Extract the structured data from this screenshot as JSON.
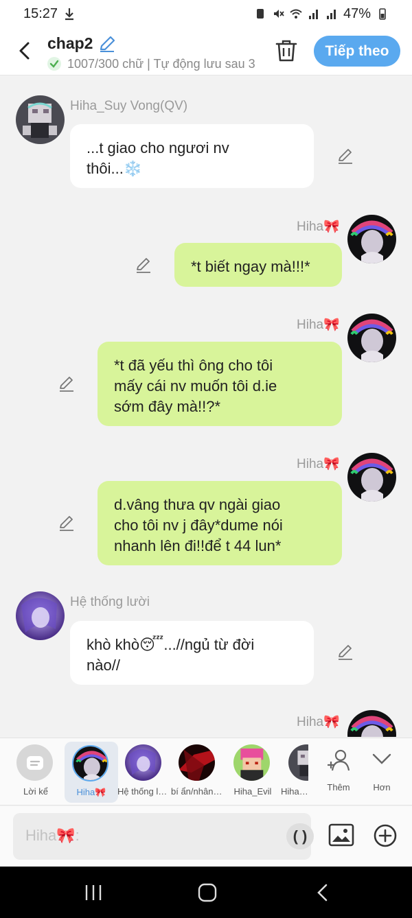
{
  "status_bar": {
    "time": "15:27",
    "battery": "47%"
  },
  "header": {
    "title": "chap2",
    "subtitle": "1007/300 chữ | Tự động lưu sau 3",
    "next_button": "Tiếp theo"
  },
  "messages": [
    {
      "side": "left",
      "name": "Hiha_Suy Vong(QV)",
      "text_lines": [
        "...t giao cho ngươi nv",
        "thôi...❄️"
      ]
    },
    {
      "side": "right",
      "name": "Hiha🎀",
      "text_lines": [
        "*t biết ngay mà!!!*"
      ]
    },
    {
      "side": "right",
      "name": "Hiha🎀",
      "text_lines": [
        "*t đã yếu thì ông cho tôi",
        "mấy cái nv muốn tôi d.ie",
        "sớm đây mà!!?*"
      ]
    },
    {
      "side": "right",
      "name": "Hiha🎀",
      "text_lines": [
        "d.vâng thưa qv ngài giao",
        "cho tôi nv j đây*dume nói",
        "nhanh lên đi!!để t 44 lun*"
      ]
    },
    {
      "side": "left",
      "name": "Hệ thống lười",
      "text_lines": [
        "khò khò😴...//ngủ từ đời",
        "nào//"
      ]
    },
    {
      "side": "right",
      "name": "Hiha🎀",
      "text_lines": []
    }
  ],
  "characters": [
    {
      "label": "Lời kể"
    },
    {
      "label": "Hiha🎀",
      "selected": true
    },
    {
      "label": "Hệ thống lười"
    },
    {
      "label": "bí ẩn/nhân vật"
    },
    {
      "label": "Hiha_Evil"
    },
    {
      "label": "Hiha_Suy Vong(QV)"
    }
  ],
  "char_actions": {
    "add": "Thêm",
    "more": "Hơn"
  },
  "composer": {
    "placeholder": "Hiha🎀:",
    "paren": "( )"
  },
  "colors": {
    "accent": "#5aa9ef",
    "bubble_right": "#d8f49a",
    "bubble_left": "#ffffff",
    "background": "#f2f2f2"
  }
}
